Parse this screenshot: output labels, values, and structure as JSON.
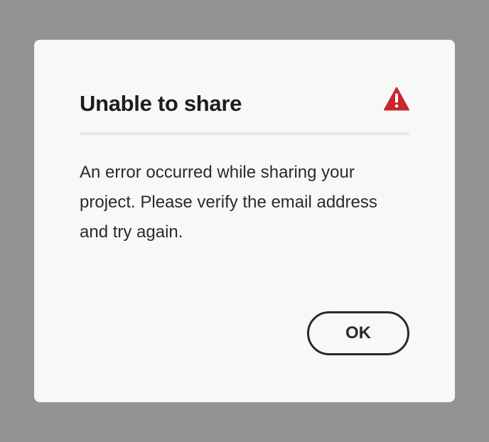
{
  "colors": {
    "backdrop": "#939393",
    "dialog_background": "#f8f8f8",
    "divider": "#e8e8e8",
    "alert_icon": "#c9252d",
    "button_border": "#2a2a2a",
    "text": "#1d1d1d"
  },
  "dialog": {
    "title": "Unable to share",
    "header_icon": "alert-triangle-icon",
    "body": "An error occurred while sharing your project. Please verify the email address and try again.",
    "primary_button_label": "OK"
  }
}
